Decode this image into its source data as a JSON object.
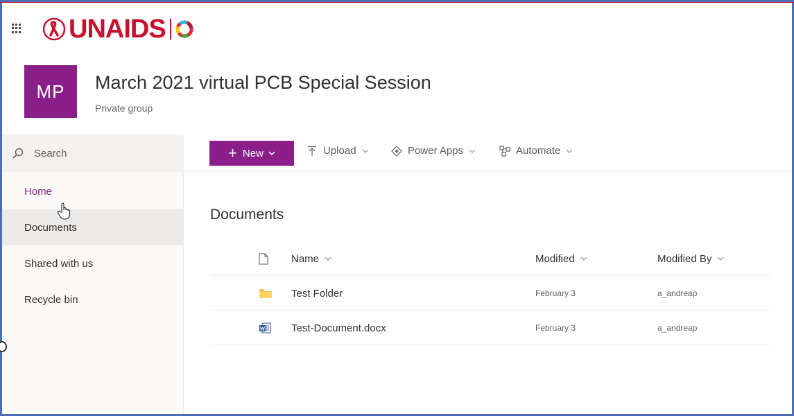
{
  "brand": {
    "name": "UNAIDS",
    "color": "#c8102e"
  },
  "group": {
    "initials": "MP",
    "title": "March 2021 virtual PCB Special Session",
    "subtitle": "Private group",
    "tile_color": "#8a1f8a"
  },
  "nav": {
    "search_label": "Search",
    "items": [
      {
        "label": "Home"
      },
      {
        "label": "Documents"
      },
      {
        "label": "Shared with us"
      },
      {
        "label": "Recycle bin"
      }
    ]
  },
  "toolbar": {
    "new_label": "New",
    "upload_label": "Upload",
    "powerapps_label": "Power Apps",
    "automate_label": "Automate"
  },
  "library": {
    "title": "Documents",
    "columns": {
      "name": "Name",
      "modified": "Modified",
      "modified_by": "Modified By"
    },
    "rows": [
      {
        "type_icon": "folder-icon",
        "name": "Test Folder",
        "modified": "February 3",
        "modified_by": "a_andreap"
      },
      {
        "type_icon": "word-doc-icon",
        "name": "Test-Document.docx",
        "modified": "February 3",
        "modified_by": "a_andreap"
      }
    ]
  }
}
